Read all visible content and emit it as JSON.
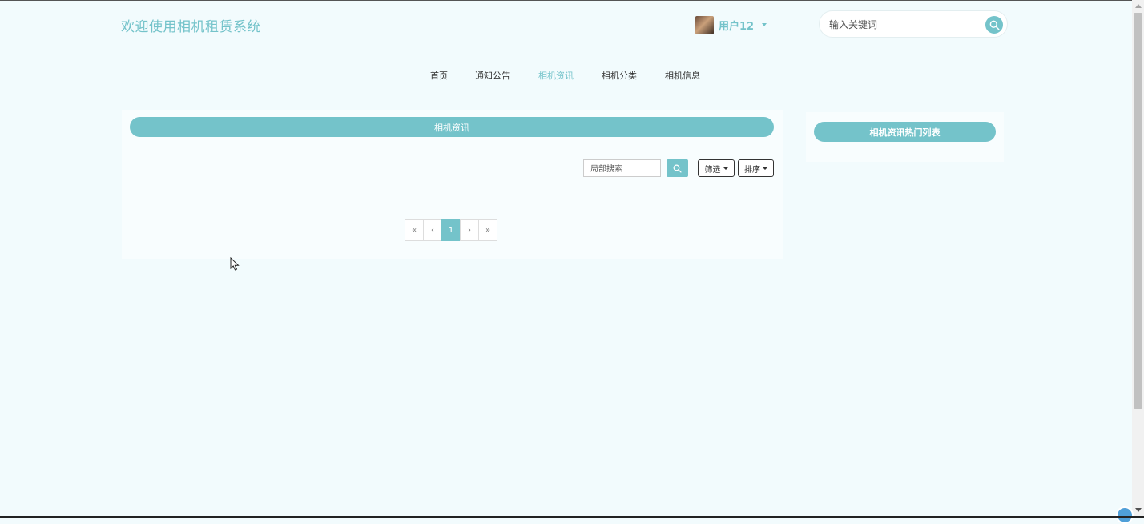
{
  "header": {
    "site_title": "欢迎使用相机租赁系统",
    "user_name": "用户12",
    "search_placeholder": "输入关键词"
  },
  "nav": {
    "items": [
      {
        "label": "首页",
        "active": false
      },
      {
        "label": "通知公告",
        "active": false
      },
      {
        "label": "相机资讯",
        "active": true
      },
      {
        "label": "相机分类",
        "active": false
      },
      {
        "label": "相机信息",
        "active": false
      }
    ]
  },
  "main": {
    "panel_title": "相机资讯",
    "local_search_placeholder": "局部搜索",
    "filter_label": "筛选",
    "sort_label": "排序",
    "pagination": {
      "first": "«",
      "prev": "‹",
      "current": "1",
      "next": "›",
      "last": "»"
    }
  },
  "sidebar": {
    "title": "相机资讯热门列表"
  },
  "colors": {
    "accent": "#74c3ca",
    "background": "#f2fbfd"
  }
}
